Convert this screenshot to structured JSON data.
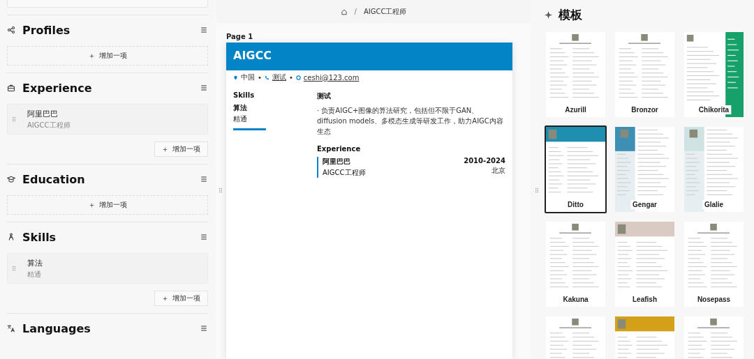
{
  "sections": [
    {
      "title": "Profiles",
      "add_label": "增加一项"
    },
    {
      "title": "Experience",
      "items": [
        {
          "title": "阿里巴巴",
          "subtitle": "AIGCC工程师"
        }
      ],
      "add_label": "增加一项"
    },
    {
      "title": "Education",
      "add_label": "增加一项"
    },
    {
      "title": "Skills",
      "items": [
        {
          "title": "算法",
          "subtitle": "精通"
        }
      ],
      "add_label": "增加一项"
    },
    {
      "title": "Languages"
    }
  ],
  "breadcrumb": {
    "separator": "/",
    "current": "AIGCC工程师"
  },
  "page": {
    "label": "Page 1",
    "name": "AIGCC",
    "separator": "•",
    "contacts": [
      {
        "kind": "location",
        "text": "中国"
      },
      {
        "kind": "phone",
        "text": "测试"
      },
      {
        "kind": "email",
        "text": "ceshi@123.com"
      }
    ],
    "skills_heading": "Skills",
    "skills": [
      {
        "name": "算法",
        "level_text": "精通",
        "level": 1
      }
    ],
    "summary_heading": "测试",
    "summary": "· 负责AIGC+图像的算法研究，包括但不限于GAN、diffusion models、多模态生成等研发工作，助力AIGC内容生态",
    "experience_heading": "Experience",
    "experience": [
      {
        "company": "阿里巴巴",
        "position": "AIGCC工程师",
        "date": "2010-2024",
        "location": "北京"
      }
    ]
  },
  "templates_title": "模板",
  "templates": [
    {
      "name": "Azurill",
      "kind": "plain",
      "selected": false
    },
    {
      "name": "Bronzor",
      "kind": "plain",
      "selected": false
    },
    {
      "name": "Chikorita",
      "kind": "right-bar",
      "color": "#16a06a",
      "selected": false
    },
    {
      "name": "Ditto",
      "kind": "header",
      "color": "#1e8fb0",
      "selected": true
    },
    {
      "name": "Gengar",
      "kind": "left-bar",
      "color": "#3d90b3",
      "selected": false
    },
    {
      "name": "Glalie",
      "kind": "left-bar",
      "color": "#cfe3e3",
      "selected": false
    },
    {
      "name": "Kakuna",
      "kind": "plain",
      "selected": false
    },
    {
      "name": "Leafish",
      "kind": "header",
      "color": "#d9cbc4",
      "selected": false
    },
    {
      "name": "Nosepass",
      "kind": "plain",
      "selected": false
    },
    {
      "kind": "plain",
      "selected": false
    },
    {
      "kind": "header",
      "color": "#d4a017",
      "selected": false
    },
    {
      "kind": "plain",
      "selected": false
    }
  ]
}
